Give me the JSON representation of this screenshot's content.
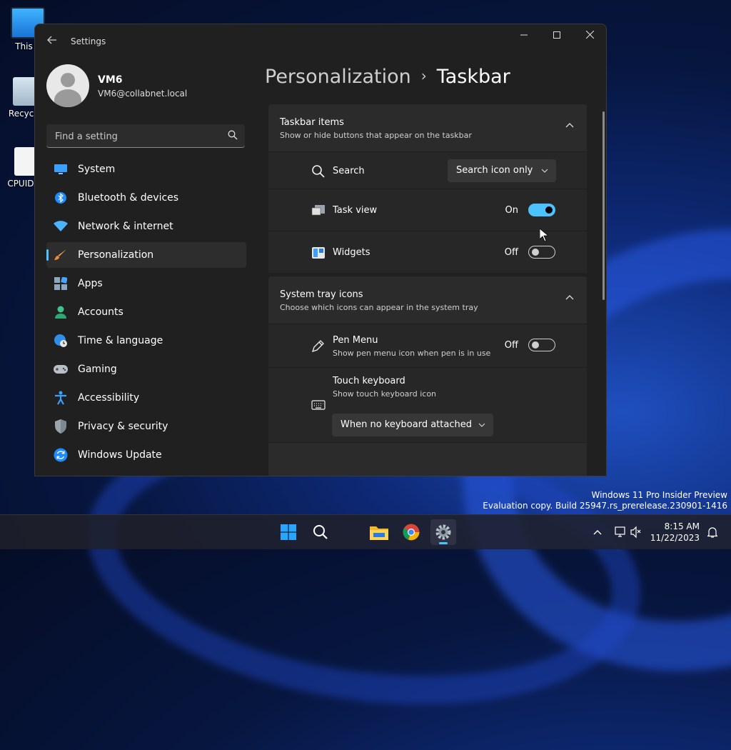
{
  "desktop": {
    "icons": [
      {
        "label": "This P"
      },
      {
        "label": "Recycle"
      },
      {
        "label": "CPUID C"
      }
    ],
    "watermark_line1": "Windows 11 Pro Insider Preview",
    "watermark_line2": "Evaluation copy. Build 25947.rs_prerelease.230901-1416"
  },
  "window": {
    "title": "Settings",
    "back_icon": "back-arrow-icon",
    "minimize_icon": "minimize-icon",
    "maximize_icon": "maximize-icon",
    "close_icon": "close-icon"
  },
  "user": {
    "name": "VM6",
    "email": "VM6@collabnet.local"
  },
  "sidebar": {
    "search_placeholder": "Find a setting",
    "items": [
      {
        "label": "System",
        "icon": "monitor-icon"
      },
      {
        "label": "Bluetooth & devices",
        "icon": "bluetooth-icon"
      },
      {
        "label": "Network & internet",
        "icon": "wifi-icon"
      },
      {
        "label": "Personalization",
        "icon": "brush-icon",
        "active": true
      },
      {
        "label": "Apps",
        "icon": "apps-icon"
      },
      {
        "label": "Accounts",
        "icon": "person-icon"
      },
      {
        "label": "Time & language",
        "icon": "globe-clock-icon"
      },
      {
        "label": "Gaming",
        "icon": "gamepad-icon"
      },
      {
        "label": "Accessibility",
        "icon": "accessibility-icon"
      },
      {
        "label": "Privacy & security",
        "icon": "shield-icon"
      },
      {
        "label": "Windows Update",
        "icon": "update-icon"
      }
    ]
  },
  "breadcrumb": {
    "parent": "Personalization",
    "separator": "›",
    "current": "Taskbar"
  },
  "taskbar_items": {
    "title": "Taskbar items",
    "subtitle": "Show or hide buttons that appear on the taskbar",
    "search": {
      "label": "Search",
      "value": "Search icon only"
    },
    "task_view": {
      "label": "Task view",
      "state": "On"
    },
    "widgets": {
      "label": "Widgets",
      "state": "Off"
    }
  },
  "system_tray": {
    "title": "System tray icons",
    "subtitle": "Choose which icons can appear in the system tray",
    "pen_menu": {
      "label": "Pen Menu",
      "sub": "Show pen menu icon when pen is in use",
      "state": "Off"
    },
    "touch_keyboard": {
      "label": "Touch keyboard",
      "sub": "Show touch keyboard icon",
      "value": "When no keyboard attached"
    }
  },
  "clock": {
    "time": "8:15 AM",
    "date": "11/22/2023"
  },
  "colors": {
    "accent": "#4cc2ff",
    "window_bg": "#202020",
    "card_bg": "#2b2b2b"
  }
}
